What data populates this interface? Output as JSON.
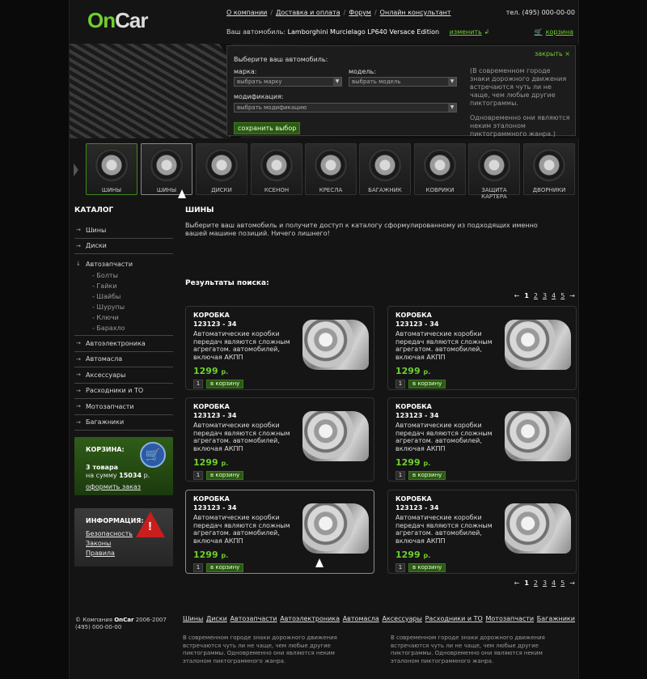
{
  "header": {
    "logo": {
      "on": "On",
      "car": "Car"
    },
    "nav": [
      "О компании",
      "Доставка и оплата",
      "Форум",
      "Онлайн консультант"
    ],
    "nav_sep": "/",
    "phone": "тел. (495) 000-00-00",
    "car_label": "Ваш автомобиль:",
    "car_name": "Lamborghini Murcielago LP640 Versace Edition",
    "change_label": "изменить",
    "cart_label": "корзина"
  },
  "selector": {
    "close_label": "закрыть ×",
    "title": "Выберите ваш автомобиль:",
    "brand_label": "марка:",
    "brand_value": "выбрать марку",
    "model_label": "модель:",
    "model_value": "выбрать модель",
    "mod_label": "модификация:",
    "mod_value": "выбрать модификацию",
    "save_label": "сохранить выбор",
    "note1": "(В современном городе знаки дорожного движения встречаются чуть ли не чаще, чем любые другие пиктограммы.",
    "note2": "Одновременно они являются неким эталоном пиктограммного жанра.)"
  },
  "categories": [
    "ШИНЫ",
    "ШИНЫ",
    "ДИСКИ",
    "КСЕНОН",
    "КРЕСЛА",
    "БАГАЖНИК",
    "КОВРИКИ",
    "ЗАЩИТА КАРТЕРА",
    "ДВОРНИКИ"
  ],
  "sidebar": {
    "title": "КАТАЛОГ",
    "items": [
      "Шины",
      "Диски",
      "Автозапчасти"
    ],
    "sub_items": [
      "- Болты",
      "- Гайки",
      "- Шайбы",
      "- Шурупы",
      "- Ключи",
      "- Барахло"
    ],
    "items_after": [
      "Автоэлектроника",
      "Автомасла",
      "Аксессуары",
      "Расходники и ТО",
      "Мотозапчасти",
      "Багажники"
    ]
  },
  "cart_box": {
    "title": "КОРЗИНА:",
    "count": "3 товара",
    "sum_label": "на сумму",
    "sum": "15034",
    "currency": "р.",
    "checkout": "оформить заказ"
  },
  "info_box": {
    "title": "ИНФОРМАЦИЯ:",
    "links": [
      "Безопасность",
      "Законы",
      "Правила"
    ]
  },
  "main": {
    "title": "ШИНЫ",
    "intro": "Выберите ваш автомобиль и получите доступ к каталогу сформулированному из подходящих именно вашей машине позиций. Ничего лишнего!",
    "results_title": "Результаты поиска:",
    "pager": {
      "prev": "←",
      "pages": [
        "1",
        "2",
        "3",
        "4",
        "5"
      ],
      "next": "→"
    }
  },
  "products": [
    {
      "name": "КОРОБКА",
      "code": "123123 - 34",
      "desc": "Автоматические коробки передач являются сложным агрегатом. автомобилей, включая АКПП",
      "price": "1299",
      "currency": "р.",
      "qty": "1",
      "buy": "в корзину"
    },
    {
      "name": "КОРОБКА",
      "code": "123123 - 34",
      "desc": "Автоматические коробки передач являются сложным агрегатом. автомобилей, включая АКПП",
      "price": "1299",
      "currency": "р.",
      "qty": "1",
      "buy": "в корзину"
    },
    {
      "name": "КОРОБКА",
      "code": "123123 - 34",
      "desc": "Автоматические коробки передач являются сложным агрегатом. автомобилей, включая АКПП",
      "price": "1299",
      "currency": "р.",
      "qty": "1",
      "buy": "в корзину"
    },
    {
      "name": "КОРОБКА",
      "code": "123123 - 34",
      "desc": "Автоматические коробки передач являются сложным агрегатом. автомобилей, включая АКПП",
      "price": "1299",
      "currency": "р.",
      "qty": "1",
      "buy": "в корзину"
    },
    {
      "name": "КОРОБКА",
      "code": "123123 - 34",
      "desc": "Автоматические коробки передач являются сложным агрегатом. автомобилей, включая АКПП",
      "price": "1299",
      "currency": "р.",
      "qty": "1",
      "buy": "в корзину"
    },
    {
      "name": "КОРОБКА",
      "code": "123123 - 34",
      "desc": "Автоматические коробки передач являются сложным агрегатом. автомобилей, включая АКПП",
      "price": "1299",
      "currency": "р.",
      "qty": "1",
      "buy": "в корзину"
    }
  ],
  "footer": {
    "copyright": "© Компания",
    "brand": "OnCar",
    "years": "2006-2007",
    "phone": "(495) 000-00-00",
    "nav": [
      "Шины",
      "Диски",
      "Автозапчасти",
      "Автоэлектроника",
      "Автомасла",
      "Аксессуары",
      "Расходники и ТО",
      "Мотозапчасти",
      "Багажники"
    ],
    "desc1": "В современном городе знаки дорожного движения встречаются чуть ли не чаще, чем любые другие пиктограммы. Одновременно они являются неким эталоном пиктограммного жанра.",
    "desc2": "В современном городе знаки дорожного движения встречаются чуть ли не чаще, чем любые другие пиктограммы. Одновременно они являются неким эталоном пиктограммного жанра."
  },
  "colors": {
    "accent": "#6fcf2e",
    "background": "#141414",
    "button": "#2c5a14"
  }
}
